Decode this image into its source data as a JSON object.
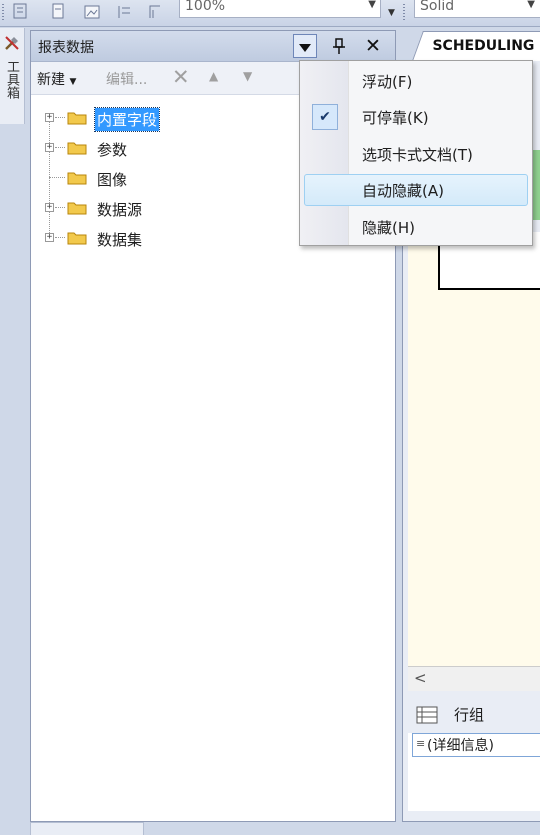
{
  "toolbar": {
    "zoom_value": "100%",
    "line_style_value": "Solid"
  },
  "toolbox_tab": {
    "label": "工具箱"
  },
  "panel": {
    "title": "报表数据",
    "new_label": "新建",
    "edit_label": "编辑...",
    "tree": [
      {
        "label": "内置字段",
        "expandable": true,
        "selected": true
      },
      {
        "label": "参数",
        "expandable": true,
        "selected": false
      },
      {
        "label": "图像",
        "expandable": false,
        "selected": false
      },
      {
        "label": "数据源",
        "expandable": true,
        "selected": false
      },
      {
        "label": "数据集",
        "expandable": true,
        "selected": false
      }
    ]
  },
  "document_tab": {
    "label": "SCHEDULING"
  },
  "row_groups": {
    "label": "行组",
    "detail_label": "(详细信息)"
  },
  "context_menu": {
    "items": [
      {
        "label": "浮动(F)",
        "checked": false,
        "highlighted": false
      },
      {
        "label": "可停靠(K)",
        "checked": true,
        "highlighted": false
      },
      {
        "label": "选项卡式文档(T)",
        "checked": false,
        "highlighted": false
      },
      {
        "label": "自动隐藏(A)",
        "checked": false,
        "highlighted": true
      },
      {
        "label": "隐藏(H)",
        "checked": false,
        "highlighted": false
      }
    ]
  },
  "colors": {
    "selection": "#3399FF",
    "canvas": "#FFFBEB",
    "highlight": "#D4EAFA"
  }
}
